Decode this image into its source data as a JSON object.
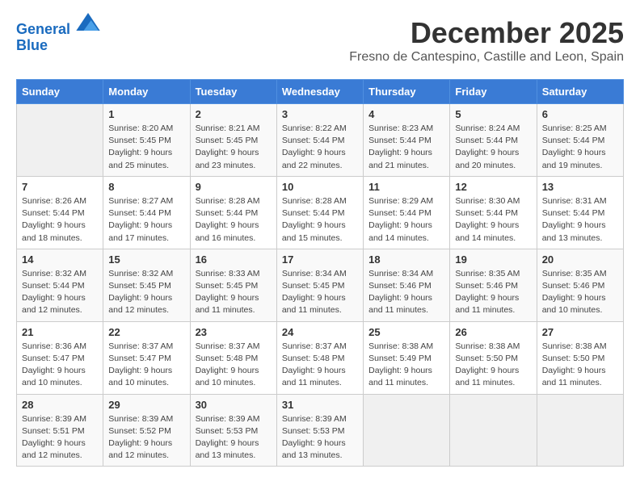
{
  "logo": {
    "line1": "General",
    "line2": "Blue"
  },
  "title": "December 2025",
  "subtitle": "Fresno de Cantespino, Castille and Leon, Spain",
  "days_header": [
    "Sunday",
    "Monday",
    "Tuesday",
    "Wednesday",
    "Thursday",
    "Friday",
    "Saturday"
  ],
  "weeks": [
    [
      {
        "day": "",
        "info": ""
      },
      {
        "day": "1",
        "info": "Sunrise: 8:20 AM\nSunset: 5:45 PM\nDaylight: 9 hours\nand 25 minutes."
      },
      {
        "day": "2",
        "info": "Sunrise: 8:21 AM\nSunset: 5:45 PM\nDaylight: 9 hours\nand 23 minutes."
      },
      {
        "day": "3",
        "info": "Sunrise: 8:22 AM\nSunset: 5:44 PM\nDaylight: 9 hours\nand 22 minutes."
      },
      {
        "day": "4",
        "info": "Sunrise: 8:23 AM\nSunset: 5:44 PM\nDaylight: 9 hours\nand 21 minutes."
      },
      {
        "day": "5",
        "info": "Sunrise: 8:24 AM\nSunset: 5:44 PM\nDaylight: 9 hours\nand 20 minutes."
      },
      {
        "day": "6",
        "info": "Sunrise: 8:25 AM\nSunset: 5:44 PM\nDaylight: 9 hours\nand 19 minutes."
      }
    ],
    [
      {
        "day": "7",
        "info": "Sunrise: 8:26 AM\nSunset: 5:44 PM\nDaylight: 9 hours\nand 18 minutes."
      },
      {
        "day": "8",
        "info": "Sunrise: 8:27 AM\nSunset: 5:44 PM\nDaylight: 9 hours\nand 17 minutes."
      },
      {
        "day": "9",
        "info": "Sunrise: 8:28 AM\nSunset: 5:44 PM\nDaylight: 9 hours\nand 16 minutes."
      },
      {
        "day": "10",
        "info": "Sunrise: 8:28 AM\nSunset: 5:44 PM\nDaylight: 9 hours\nand 15 minutes."
      },
      {
        "day": "11",
        "info": "Sunrise: 8:29 AM\nSunset: 5:44 PM\nDaylight: 9 hours\nand 14 minutes."
      },
      {
        "day": "12",
        "info": "Sunrise: 8:30 AM\nSunset: 5:44 PM\nDaylight: 9 hours\nand 14 minutes."
      },
      {
        "day": "13",
        "info": "Sunrise: 8:31 AM\nSunset: 5:44 PM\nDaylight: 9 hours\nand 13 minutes."
      }
    ],
    [
      {
        "day": "14",
        "info": "Sunrise: 8:32 AM\nSunset: 5:44 PM\nDaylight: 9 hours\nand 12 minutes."
      },
      {
        "day": "15",
        "info": "Sunrise: 8:32 AM\nSunset: 5:45 PM\nDaylight: 9 hours\nand 12 minutes."
      },
      {
        "day": "16",
        "info": "Sunrise: 8:33 AM\nSunset: 5:45 PM\nDaylight: 9 hours\nand 11 minutes."
      },
      {
        "day": "17",
        "info": "Sunrise: 8:34 AM\nSunset: 5:45 PM\nDaylight: 9 hours\nand 11 minutes."
      },
      {
        "day": "18",
        "info": "Sunrise: 8:34 AM\nSunset: 5:46 PM\nDaylight: 9 hours\nand 11 minutes."
      },
      {
        "day": "19",
        "info": "Sunrise: 8:35 AM\nSunset: 5:46 PM\nDaylight: 9 hours\nand 11 minutes."
      },
      {
        "day": "20",
        "info": "Sunrise: 8:35 AM\nSunset: 5:46 PM\nDaylight: 9 hours\nand 10 minutes."
      }
    ],
    [
      {
        "day": "21",
        "info": "Sunrise: 8:36 AM\nSunset: 5:47 PM\nDaylight: 9 hours\nand 10 minutes."
      },
      {
        "day": "22",
        "info": "Sunrise: 8:37 AM\nSunset: 5:47 PM\nDaylight: 9 hours\nand 10 minutes."
      },
      {
        "day": "23",
        "info": "Sunrise: 8:37 AM\nSunset: 5:48 PM\nDaylight: 9 hours\nand 10 minutes."
      },
      {
        "day": "24",
        "info": "Sunrise: 8:37 AM\nSunset: 5:48 PM\nDaylight: 9 hours\nand 11 minutes."
      },
      {
        "day": "25",
        "info": "Sunrise: 8:38 AM\nSunset: 5:49 PM\nDaylight: 9 hours\nand 11 minutes."
      },
      {
        "day": "26",
        "info": "Sunrise: 8:38 AM\nSunset: 5:50 PM\nDaylight: 9 hours\nand 11 minutes."
      },
      {
        "day": "27",
        "info": "Sunrise: 8:38 AM\nSunset: 5:50 PM\nDaylight: 9 hours\nand 11 minutes."
      }
    ],
    [
      {
        "day": "28",
        "info": "Sunrise: 8:39 AM\nSunset: 5:51 PM\nDaylight: 9 hours\nand 12 minutes."
      },
      {
        "day": "29",
        "info": "Sunrise: 8:39 AM\nSunset: 5:52 PM\nDaylight: 9 hours\nand 12 minutes."
      },
      {
        "day": "30",
        "info": "Sunrise: 8:39 AM\nSunset: 5:53 PM\nDaylight: 9 hours\nand 13 minutes."
      },
      {
        "day": "31",
        "info": "Sunrise: 8:39 AM\nSunset: 5:53 PM\nDaylight: 9 hours\nand 13 minutes."
      },
      {
        "day": "",
        "info": ""
      },
      {
        "day": "",
        "info": ""
      },
      {
        "day": "",
        "info": ""
      }
    ]
  ]
}
